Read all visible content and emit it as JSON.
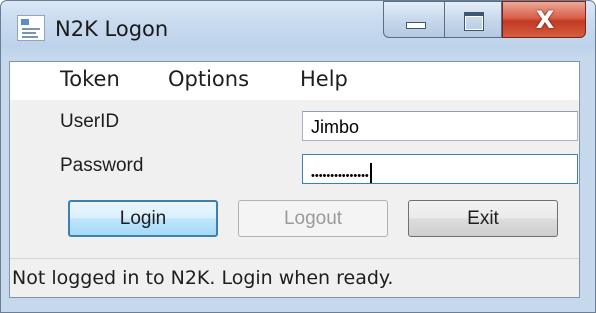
{
  "window": {
    "title": "N2K Logon"
  },
  "caption_buttons": {
    "close_glyph": "X"
  },
  "menu": [
    {
      "label": "Token"
    },
    {
      "label": "Options"
    },
    {
      "label": "Help"
    }
  ],
  "form": {
    "userid_label": "UserID",
    "userid_value": "Jimbo",
    "password_label": "Password",
    "password_mask": "•••••••••••••••"
  },
  "buttons": {
    "login": "Login",
    "logout": "Logout",
    "exit": "Exit"
  },
  "status": {
    "text": "Not logged in to N2K. Login when ready."
  },
  "colors": {
    "accent": "#3c7fb1",
    "close": "#c23a24",
    "frame": "#c6d8ec"
  },
  "icons": {
    "app": "app-window-icon",
    "minimize": "minimize-icon",
    "maximize": "maximize-icon",
    "close": "close-icon"
  }
}
